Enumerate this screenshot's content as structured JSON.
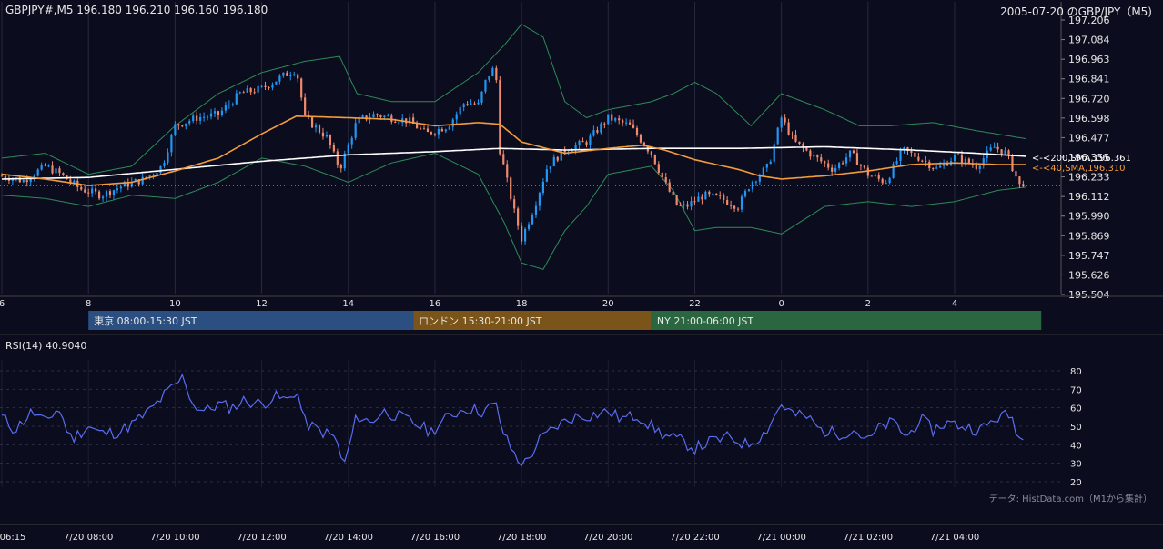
{
  "header": {
    "symbol_line": "GBPJPY#,M5 196.180 196.210 196.160 196.180",
    "chart_title": "2005-07-20 のGBP/JPY（M5)"
  },
  "footer": {
    "data_source": "データ: HistData.com（M1から集計）"
  },
  "colors": {
    "background": "#0b0c1e",
    "grid": "#3a3d55",
    "candle_up": "#2196f3",
    "candle_down": "#ef8a6c",
    "sma40": "#f39c3c",
    "sma200": "#ffffff",
    "bollinger": "#2e8b57",
    "rsi_line": "#5a6cf0",
    "session_tokyo": "#2a4f80",
    "session_london": "#7a5418",
    "session_ny": "#2a6640"
  },
  "chart_data": [
    {
      "type": "candlestick",
      "name": "price",
      "ylim": [
        195.504,
        197.206
      ],
      "yticks": [
        "197.206",
        "197.084",
        "196.963",
        "196.841",
        "196.720",
        "196.598",
        "196.477",
        "196.355",
        "196.233",
        "196.112",
        "195.990",
        "195.869",
        "195.747",
        "195.626",
        "195.504"
      ],
      "xticks_hour": [
        "6",
        "8",
        "10",
        "12",
        "14",
        "16",
        "18",
        "20",
        "22",
        "0",
        "2",
        "4"
      ],
      "xticks_datetime": [
        "06:15",
        "7/20 08:00",
        "7/20 10:00",
        "7/20 12:00",
        "7/20 14:00",
        "7/20 16:00",
        "7/20 18:00",
        "7/20 20:00",
        "7/20 22:00",
        "7/21 00:00",
        "7/21 02:00",
        "7/21 04:00"
      ],
      "current_price": 196.18,
      "annotations": [
        {
          "label": "<-<200,SMA,196.361",
          "value": 196.361
        },
        {
          "label": "<-<40,SMA,196.310",
          "value": 196.31
        }
      ],
      "sessions": [
        {
          "label": "東京 08:00-15:30 JST",
          "start": 8.0,
          "end": 15.5
        },
        {
          "label": "ロンドン 15:30-21:00 JST",
          "start": 15.5,
          "end": 21.0
        },
        {
          "label": "NY 21:00-06:00 JST",
          "start": 21.0,
          "end": 30.0
        }
      ],
      "x_range_hours": [
        6.0,
        30.5
      ],
      "close_anchors": [
        [
          6.0,
          196.24
        ],
        [
          6.5,
          196.21
        ],
        [
          7.0,
          196.3
        ],
        [
          7.3,
          196.26
        ],
        [
          7.8,
          196.16
        ],
        [
          8.3,
          196.12
        ],
        [
          8.8,
          196.18
        ],
        [
          9.3,
          196.22
        ],
        [
          9.7,
          196.3
        ],
        [
          10.0,
          196.55
        ],
        [
          10.5,
          196.6
        ],
        [
          11.0,
          196.62
        ],
        [
          11.5,
          196.75
        ],
        [
          12.0,
          196.78
        ],
        [
          12.5,
          196.86
        ],
        [
          12.8,
          196.9
        ],
        [
          13.0,
          196.6
        ],
        [
          13.5,
          196.48
        ],
        [
          13.8,
          196.28
        ],
        [
          14.2,
          196.58
        ],
        [
          14.6,
          196.62
        ],
        [
          15.0,
          196.6
        ],
        [
          15.4,
          196.58
        ],
        [
          15.8,
          196.5
        ],
        [
          16.3,
          196.55
        ],
        [
          16.7,
          196.7
        ],
        [
          17.0,
          196.68
        ],
        [
          17.2,
          196.85
        ],
        [
          17.4,
          196.92
        ],
        [
          17.5,
          196.4
        ],
        [
          17.8,
          196.05
        ],
        [
          18.0,
          195.85
        ],
        [
          18.3,
          196.05
        ],
        [
          18.6,
          196.3
        ],
        [
          19.0,
          196.4
        ],
        [
          19.5,
          196.45
        ],
        [
          20.0,
          196.6
        ],
        [
          20.5,
          196.55
        ],
        [
          21.0,
          196.38
        ],
        [
          21.3,
          196.2
        ],
        [
          21.6,
          196.05
        ],
        [
          21.8,
          196.05
        ],
        [
          22.2,
          196.12
        ],
        [
          22.6,
          196.1
        ],
        [
          23.0,
          196.05
        ],
        [
          23.3,
          196.2
        ],
        [
          23.7,
          196.3
        ],
        [
          24.0,
          196.6
        ],
        [
          24.3,
          196.45
        ],
        [
          24.8,
          196.35
        ],
        [
          25.2,
          196.28
        ],
        [
          25.6,
          196.38
        ],
        [
          26.0,
          196.25
        ],
        [
          26.4,
          196.2
        ],
        [
          26.8,
          196.4
        ],
        [
          27.2,
          196.35
        ],
        [
          27.6,
          196.28
        ],
        [
          28.0,
          196.36
        ],
        [
          28.5,
          196.3
        ],
        [
          28.9,
          196.42
        ],
        [
          29.2,
          196.38
        ],
        [
          29.5,
          196.18
        ],
        [
          29.65,
          196.21
        ]
      ],
      "sma40_anchors": [
        [
          6.0,
          196.25
        ],
        [
          7.0,
          196.22
        ],
        [
          8.0,
          196.18
        ],
        [
          9.0,
          196.2
        ],
        [
          10.0,
          196.27
        ],
        [
          11.0,
          196.35
        ],
        [
          12.0,
          196.5
        ],
        [
          12.8,
          196.61
        ],
        [
          14.0,
          196.6
        ],
        [
          15.0,
          196.59
        ],
        [
          16.0,
          196.55
        ],
        [
          17.0,
          196.57
        ],
        [
          17.5,
          196.56
        ],
        [
          18.0,
          196.45
        ],
        [
          19.0,
          196.38
        ],
        [
          20.0,
          196.41
        ],
        [
          20.8,
          196.43
        ],
        [
          21.3,
          196.4
        ],
        [
          22.0,
          196.34
        ],
        [
          23.0,
          196.28
        ],
        [
          23.5,
          196.24
        ],
        [
          24.0,
          196.22
        ],
        [
          25.0,
          196.24
        ],
        [
          26.0,
          196.27
        ],
        [
          27.0,
          196.31
        ],
        [
          28.0,
          196.32
        ],
        [
          29.0,
          196.31
        ],
        [
          29.65,
          196.31
        ]
      ],
      "sma200_anchors": [
        [
          6.0,
          196.22
        ],
        [
          8.0,
          196.23
        ],
        [
          10.0,
          196.28
        ],
        [
          12.0,
          196.33
        ],
        [
          14.0,
          196.37
        ],
        [
          16.0,
          196.39
        ],
        [
          17.5,
          196.41
        ],
        [
          19.0,
          196.4
        ],
        [
          21.0,
          196.41
        ],
        [
          23.0,
          196.41
        ],
        [
          25.0,
          196.42
        ],
        [
          27.0,
          196.4
        ],
        [
          28.5,
          196.38
        ],
        [
          29.65,
          196.361
        ]
      ],
      "bb_upper_anchors": [
        [
          6.0,
          196.35
        ],
        [
          7.0,
          196.38
        ],
        [
          8.0,
          196.25
        ],
        [
          9.0,
          196.3
        ],
        [
          10.0,
          196.55
        ],
        [
          11.0,
          196.75
        ],
        [
          12.0,
          196.88
        ],
        [
          13.0,
          196.95
        ],
        [
          13.8,
          196.98
        ],
        [
          14.2,
          196.75
        ],
        [
          15.0,
          196.7
        ],
        [
          16.0,
          196.7
        ],
        [
          17.0,
          196.88
        ],
        [
          17.6,
          197.05
        ],
        [
          18.0,
          197.18
        ],
        [
          18.5,
          197.1
        ],
        [
          19.0,
          196.7
        ],
        [
          19.5,
          196.6
        ],
        [
          20.0,
          196.65
        ],
        [
          21.0,
          196.7
        ],
        [
          21.5,
          196.75
        ],
        [
          22.0,
          196.82
        ],
        [
          22.5,
          196.75
        ],
        [
          23.3,
          196.55
        ],
        [
          24.0,
          196.75
        ],
        [
          25.0,
          196.65
        ],
        [
          25.8,
          196.55
        ],
        [
          26.5,
          196.55
        ],
        [
          27.5,
          196.57
        ],
        [
          28.5,
          196.52
        ],
        [
          29.65,
          196.47
        ]
      ],
      "bb_lower_anchors": [
        [
          6.0,
          196.12
        ],
        [
          7.0,
          196.1
        ],
        [
          8.0,
          196.05
        ],
        [
          9.0,
          196.12
        ],
        [
          10.0,
          196.1
        ],
        [
          11.0,
          196.2
        ],
        [
          12.0,
          196.35
        ],
        [
          13.0,
          196.3
        ],
        [
          14.0,
          196.2
        ],
        [
          15.0,
          196.32
        ],
        [
          16.0,
          196.38
        ],
        [
          17.0,
          196.25
        ],
        [
          17.6,
          195.95
        ],
        [
          18.0,
          195.7
        ],
        [
          18.5,
          195.66
        ],
        [
          19.0,
          195.9
        ],
        [
          19.5,
          196.05
        ],
        [
          20.0,
          196.25
        ],
        [
          21.0,
          196.3
        ],
        [
          21.5,
          196.15
        ],
        [
          22.0,
          195.9
        ],
        [
          22.5,
          195.92
        ],
        [
          23.3,
          195.92
        ],
        [
          24.0,
          195.88
        ],
        [
          25.0,
          196.05
        ],
        [
          26.0,
          196.08
        ],
        [
          27.0,
          196.05
        ],
        [
          28.0,
          196.08
        ],
        [
          29.0,
          196.15
        ],
        [
          29.65,
          196.17
        ]
      ]
    },
    {
      "type": "line",
      "name": "RSI(14)",
      "label": "RSI(14) 40.9040",
      "ylim": [
        20,
        80
      ],
      "yticks": [
        "80",
        "70",
        "60",
        "50",
        "40",
        "30",
        "20"
      ],
      "anchors": [
        [
          6.0,
          55
        ],
        [
          6.3,
          48
        ],
        [
          6.7,
          58
        ],
        [
          7.0,
          52
        ],
        [
          7.3,
          60
        ],
        [
          7.6,
          43
        ],
        [
          8.0,
          50
        ],
        [
          8.3,
          46
        ],
        [
          8.7,
          47
        ],
        [
          9.0,
          51
        ],
        [
          9.4,
          58
        ],
        [
          9.8,
          68
        ],
        [
          10.0,
          72
        ],
        [
          10.2,
          77
        ],
        [
          10.4,
          62
        ],
        [
          10.7,
          58
        ],
        [
          11.0,
          62
        ],
        [
          11.3,
          60
        ],
        [
          11.6,
          64
        ],
        [
          12.0,
          62
        ],
        [
          12.3,
          66
        ],
        [
          12.6,
          64
        ],
        [
          12.8,
          70
        ],
        [
          13.0,
          52
        ],
        [
          13.3,
          48
        ],
        [
          13.7,
          44
        ],
        [
          13.9,
          28
        ],
        [
          14.2,
          56
        ],
        [
          14.5,
          52
        ],
        [
          14.8,
          58
        ],
        [
          15.1,
          56
        ],
        [
          15.5,
          52
        ],
        [
          15.9,
          47
        ],
        [
          16.3,
          55
        ],
        [
          16.7,
          60
        ],
        [
          17.1,
          58
        ],
        [
          17.4,
          62
        ],
        [
          17.6,
          45
        ],
        [
          17.9,
          32
        ],
        [
          18.1,
          30
        ],
        [
          18.4,
          42
        ],
        [
          18.8,
          50
        ],
        [
          19.2,
          55
        ],
        [
          19.6,
          56
        ],
        [
          20.0,
          58
        ],
        [
          20.3,
          54
        ],
        [
          20.7,
          56
        ],
        [
          21.0,
          50
        ],
        [
          21.3,
          45
        ],
        [
          21.7,
          42
        ],
        [
          22.0,
          38
        ],
        [
          22.4,
          42
        ],
        [
          22.8,
          44
        ],
        [
          23.2,
          40
        ],
        [
          23.6,
          46
        ],
        [
          24.0,
          62
        ],
        [
          24.3,
          56
        ],
        [
          24.6,
          55
        ],
        [
          24.9,
          48
        ],
        [
          25.3,
          46
        ],
        [
          25.7,
          48
        ],
        [
          26.0,
          42
        ],
        [
          26.3,
          50
        ],
        [
          26.6,
          52
        ],
        [
          26.9,
          44
        ],
        [
          27.2,
          54
        ],
        [
          27.5,
          48
        ],
        [
          27.8,
          52
        ],
        [
          28.2,
          50
        ],
        [
          28.6,
          48
        ],
        [
          29.0,
          55
        ],
        [
          29.3,
          56
        ],
        [
          29.5,
          44
        ],
        [
          29.65,
          40.9
        ]
      ]
    }
  ]
}
